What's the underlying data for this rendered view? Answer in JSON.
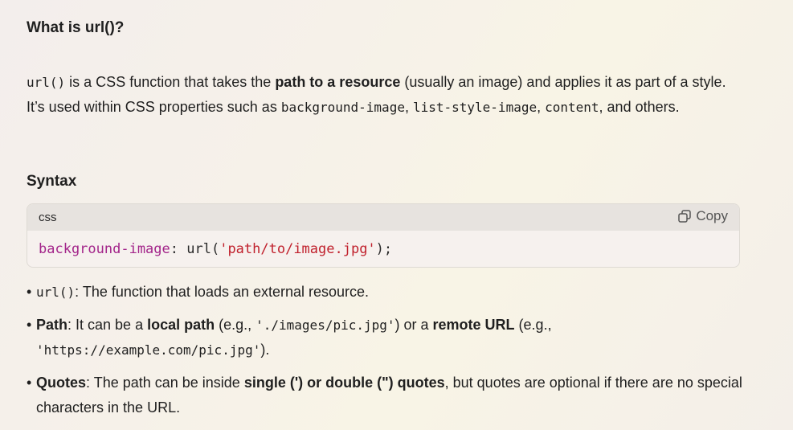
{
  "question": "What is url()?",
  "intro": {
    "p1_code": "url()",
    "p1_text": " is a CSS function that takes the ",
    "p1_bold": "path to a resource",
    "p1_text2": " (usually an image) and applies it as part of a style. It’s used within CSS properties such as ",
    "code_bg": "background-image",
    "sep1": ", ",
    "code_ls": "list-style-image",
    "sep2": ", ",
    "code_content": "content",
    "p1_end": ", and others."
  },
  "syntax_heading": "Syntax",
  "code_block": {
    "language": "css",
    "copy_label": "Copy",
    "prop": "background-image",
    "colon": ": ",
    "func": "url(",
    "string": "'path/to/image.jpg'",
    "close": ");"
  },
  "bullets": {
    "b1_code": "url()",
    "b1_text": ": The function that loads an external resource.",
    "b2_bold": "Path",
    "b2_text": ": It can be a ",
    "b2_bold2": "local path",
    "b2_text2": " (e.g., ",
    "b2_code1": "'./images/pic.jpg'",
    "b2_text3": ") or a ",
    "b2_bold3": "remote URL",
    "b2_text4": " (e.g., ",
    "b2_code2": "'https://example.com/pic.jpg'",
    "b2_text5": ").",
    "b3_bold": "Quotes",
    "b3_text": ": The path can be inside ",
    "b3_bold2": "single (') or double (\") quotes",
    "b3_text2": ", but quotes are optional if there are no special characters in the URL."
  }
}
